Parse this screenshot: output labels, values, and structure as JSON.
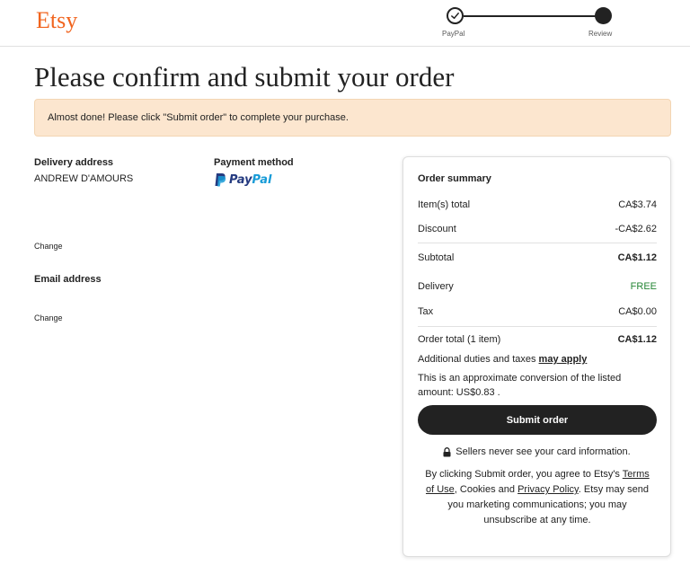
{
  "header": {
    "logo": "Etsy",
    "steps": [
      {
        "label": "PayPal",
        "state": "completed"
      },
      {
        "label": "Review",
        "state": "current"
      }
    ]
  },
  "page_title": "Please confirm and submit your order",
  "banner": "Almost done! Please click \"Submit order\" to complete your purchase.",
  "delivery": {
    "label": "Delivery address",
    "name": "ANDREW D'AMOURS",
    "change": "Change"
  },
  "payment": {
    "label": "Payment method",
    "method_pay": "Pay",
    "method_pal": "Pal"
  },
  "email": {
    "label": "Email address",
    "change": "Change"
  },
  "summary": {
    "title": "Order summary",
    "items_total_label": "Item(s) total",
    "items_total_value": "CA$3.74",
    "discount_label": "Discount",
    "discount_value": "-CA$2.62",
    "subtotal_label": "Subtotal",
    "subtotal_value": "CA$1.12",
    "delivery_label": "Delivery",
    "delivery_value": "FREE",
    "tax_label": "Tax",
    "tax_value": "CA$0.00",
    "order_total_label": "Order total (1 item)",
    "order_total_value": "CA$1.12",
    "duties_text": "Additional duties and taxes",
    "duties_link": "may apply",
    "conversion_note": "This is an approximate conversion of the listed amount: US$0.83 .",
    "submit_label": "Submit order",
    "secure_note": "Sellers never see your card information.",
    "terms_1": "By clicking Submit order, you agree to Etsy's",
    "terms_link_1": "Terms of Use",
    "terms_2": ", Cookies and",
    "terms_link_2": "Privacy Policy",
    "terms_3": ". Etsy may send you marketing communications; you may unsubscribe at any time."
  },
  "colors": {
    "brand": "#f1641e",
    "banner_bg": "#fce6cf",
    "free_green": "#258635",
    "button": "#222222"
  },
  "icons": [
    "check-icon",
    "lock-icon",
    "paypal-icon"
  ]
}
